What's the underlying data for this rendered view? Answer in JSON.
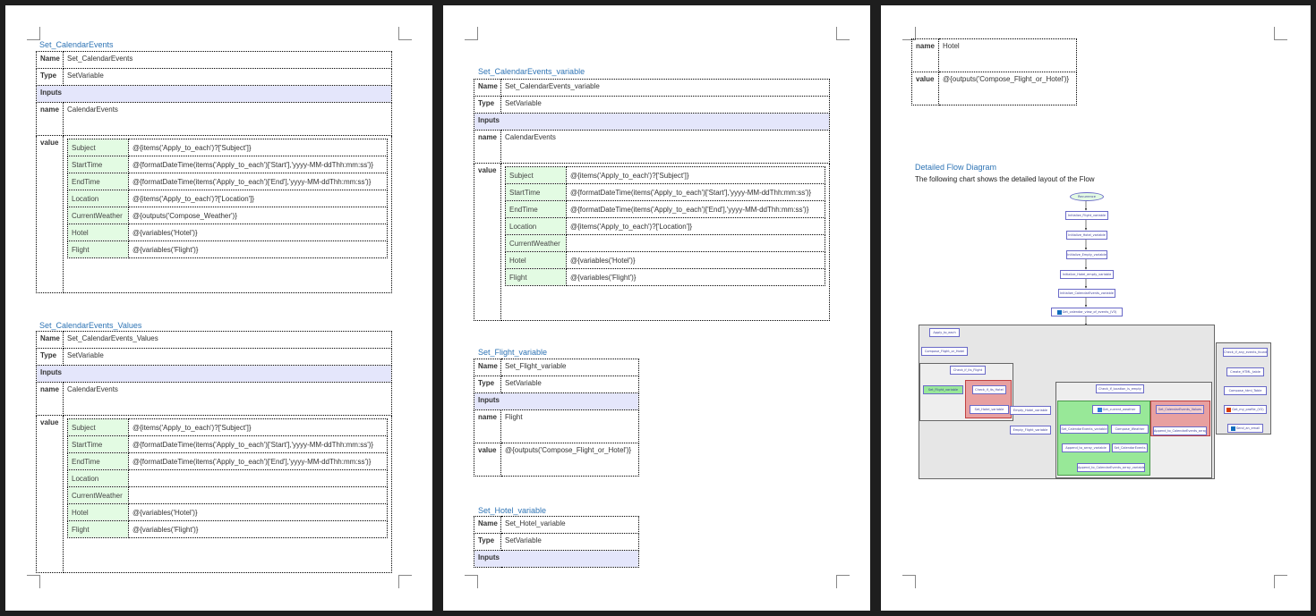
{
  "page1": {
    "sections": [
      {
        "heading": "Set_CalendarEvents",
        "name_label": "Name",
        "name_value": "Set_CalendarEvents",
        "type_label": "Type",
        "type_value": "SetVariable",
        "inputs_label": "Inputs",
        "param_name_label": "name",
        "param_name_value": "CalendarEvents",
        "value_label": "value",
        "rows": [
          {
            "key": "Subject",
            "val": "@{items('Apply_to_each')?['Subject']}"
          },
          {
            "key": "StartTime",
            "val": "@{formatDateTime(items('Apply_to_each')['Start'],'yyyy-MM-ddThh:mm:ss')}"
          },
          {
            "key": "EndTime",
            "val": "@{formatDateTime(items('Apply_to_each')['End'],'yyyy-MM-ddThh:mm:ss')}"
          },
          {
            "key": "Location",
            "val": "@{items('Apply_to_each')?['Location']}"
          },
          {
            "key": "CurrentWeather",
            "val": "@{outputs('Compose_Weather')}"
          },
          {
            "key": "Hotel",
            "val": "@{variables('Hotel')}"
          },
          {
            "key": "Flight",
            "val": "@{variables('Flight')}"
          }
        ]
      },
      {
        "heading": "Set_CalendarEvents_Values",
        "name_label": "Name",
        "name_value": "Set_CalendarEvents_Values",
        "type_label": "Type",
        "type_value": "SetVariable",
        "inputs_label": "Inputs",
        "param_name_label": "name",
        "param_name_value": "CalendarEvents",
        "value_label": "value",
        "rows": [
          {
            "key": "Subject",
            "val": "@{items('Apply_to_each')?['Subject']}"
          },
          {
            "key": "StartTime",
            "val": "@{formatDateTime(items('Apply_to_each')['Start'],'yyyy-MM-ddThh:mm:ss')}"
          },
          {
            "key": "EndTime",
            "val": "@{formatDateTime(items('Apply_to_each')['End'],'yyyy-MM-ddThh:mm:ss')}"
          },
          {
            "key": "Location",
            "val": ""
          },
          {
            "key": "CurrentWeather",
            "val": ""
          },
          {
            "key": "Hotel",
            "val": "@{variables('Hotel')}"
          },
          {
            "key": "Flight",
            "val": "@{variables('Flight')}"
          }
        ]
      }
    ]
  },
  "page2": {
    "calendar": {
      "heading": "Set_CalendarEvents_variable",
      "name_label": "Name",
      "name_value": "Set_CalendarEvents_variable",
      "type_label": "Type",
      "type_value": "SetVariable",
      "inputs_label": "Inputs",
      "param_name_label": "name",
      "param_name_value": "CalendarEvents",
      "value_label": "value",
      "rows": [
        {
          "key": "Subject",
          "val": "@{items('Apply_to_each')?['Subject']}"
        },
        {
          "key": "StartTime",
          "val": "@{formatDateTime(items('Apply_to_each')['Start'],'yyyy-MM-ddThh:mm:ss')}"
        },
        {
          "key": "EndTime",
          "val": "@{formatDateTime(items('Apply_to_each')['End'],'yyyy-MM-ddThh:mm:ss')}"
        },
        {
          "key": "Location",
          "val": "@{items('Apply_to_each')?['Location']}"
        },
        {
          "key": "CurrentWeather",
          "val": ""
        },
        {
          "key": "Hotel",
          "val": "@{variables('Hotel')}"
        },
        {
          "key": "Flight",
          "val": "@{variables('Flight')}"
        }
      ]
    },
    "flight": {
      "heading": "Set_Flight_variable",
      "name_label": "Name",
      "name_value": "Set_Flight_variable",
      "type_label": "Type",
      "type_value": "SetVariable",
      "inputs_label": "Inputs",
      "param_name_label": "name",
      "param_name_value": "Flight",
      "value_label": "value",
      "value_value": "@{outputs('Compose_Flight_or_Hotel')}"
    },
    "hotel": {
      "heading": "Set_Hotel_variable",
      "name_label": "Name",
      "name_value": "Set_Hotel_variable",
      "type_label": "Type",
      "type_value": "SetVariable",
      "inputs_label": "Inputs"
    }
  },
  "page3": {
    "cont_name_label": "name",
    "cont_name_value": "Hotel",
    "cont_value_label": "value",
    "cont_value_value": "@{outputs('Compose_Flight_or_Hotel')}",
    "diagram_title": "Detailed Flow Diagram",
    "diagram_text": "The following chart shows the detailed layout of the Flow",
    "diagram": {
      "icons": [
        "outlook-icon",
        "office-icon"
      ],
      "nodes": {
        "recurrence": "Recurrence",
        "init_flight": "Initialize_Flight_variable",
        "init_hotel": "Initialize_Hotel_variable",
        "init_empty": "Initialize_Empty_variable",
        "init_empty_hotel": "Initialize_Hotel_empty_variable",
        "init_calendar": "Initialize_CalendarEvents_variable",
        "get_calendar": "Get_calendar_view_of_events_(V3)",
        "apply": "Apply_to_each",
        "compose_fh": "Compose_Flight_or_Hotel",
        "check_flight": "Check_if_its_Flight",
        "set_flight": "Set_Flight_variable",
        "check_hotel": "Check_if_its_Hotel",
        "set_hotel": "Set_Hotel_variable",
        "check_loc": "Check_if_location_is_empty",
        "empty_hotel": "Empty_Hotel_variable",
        "empty_flight": "Empty_Flight_variable",
        "get_weather": "Get_current_weather",
        "set_cal_var": "Set_CalendarEvents_variable",
        "compose_weather": "Compose_Weather",
        "append_array": "Append_to_array_variable",
        "set_cal": "Set_CalendarEvents",
        "append_cal_array": "Append_to_CalendarEvents_array_variable",
        "set_cal_values": "Set_CalendarEvents_Values",
        "append_cal_empty": "Append_to_CalendarEvents_array",
        "check_events": "Check_if_any_events_found",
        "create_html": "Create_HTML_table",
        "compose_html": "Compose_html_Table",
        "get_profile": "Get_my_profile_(V2)",
        "send_email": "Send_an_email"
      }
    }
  }
}
